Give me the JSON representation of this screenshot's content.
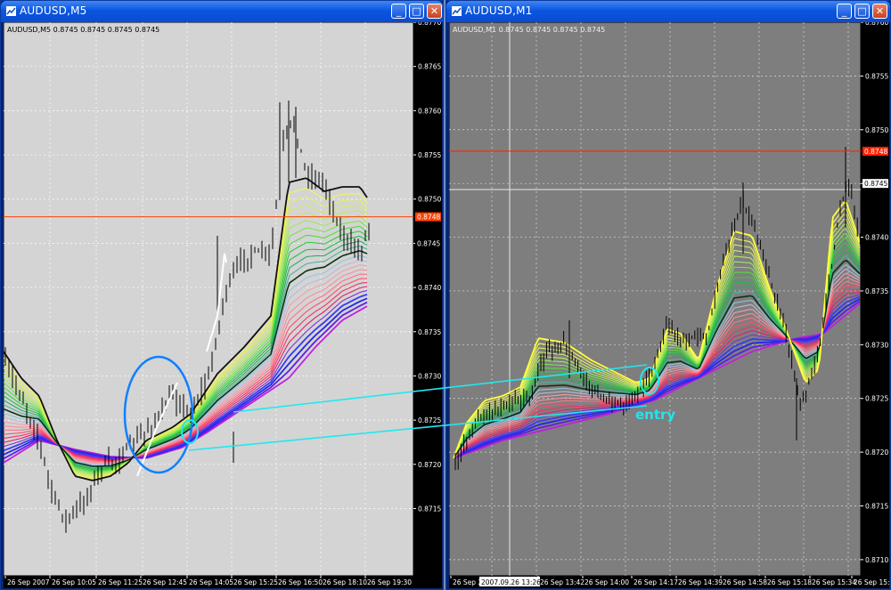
{
  "windows": [
    {
      "title": "AUDUSD,M5",
      "info": "AUDUSD,M5  0.8745 0.8745 0.8745 0.8745",
      "buttons": {
        "minimize": "_",
        "maximize": "□",
        "close": "✕"
      },
      "price_ticks": [
        "0.8770",
        "0.8765",
        "0.8760",
        "0.8755",
        "0.8750",
        "0.8745",
        "0.8740",
        "0.8735",
        "0.8730",
        "0.8725",
        "0.8720",
        "0.8715"
      ],
      "time_ticks": [
        "26 Sep 2007",
        "26 Sep 10:05",
        "26 Sep 11:25",
        "26 Sep 12:45",
        "26 Sep 14:05",
        "26 Sep 15:25",
        "26 Sep 16:50",
        "26 Sep 18:10",
        "26 Sep 19:30"
      ],
      "red_line_label": "0.8748",
      "current_price_label": "0.8745",
      "colors": {
        "background": "#d4d4d4",
        "candles": "#000000",
        "red_line": "#ff4000"
      }
    },
    {
      "title": "AUDUSD,M1",
      "info": "AUDUSD,M1  0.8745 0.8745 0.8745 0.8745",
      "buttons": {
        "minimize": "_",
        "maximize": "□",
        "close": "✕"
      },
      "price_ticks": [
        "0.8760",
        "0.8755",
        "0.8750",
        "0.8745",
        "0.8740",
        "0.8735",
        "0.8730",
        "0.8725",
        "0.8720",
        "0.8715",
        "0.8710"
      ],
      "time_ticks": [
        "26 Sep 200",
        "26 Sep 13:42",
        "26 Sep 14:00",
        "26 Sep 14:17",
        "26 Sep 14:39",
        "26 Sep 14:58",
        "26 Sep 15:18",
        "26 Sep 15:34",
        "26 Sep 15:5"
      ],
      "cursor_time_label": "2007.09.26 13:26",
      "red_line_label": "0.8748",
      "current_price_label": "0.8745",
      "colors": {
        "background": "#7e7e7e",
        "candles": "#000000",
        "red_line": "#ff2000"
      }
    }
  ],
  "annotation": {
    "label": "entry",
    "color": "#22e4ee"
  }
}
